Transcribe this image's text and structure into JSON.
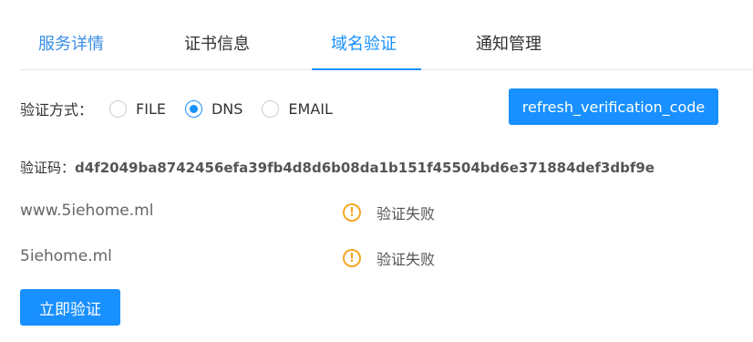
{
  "tabs": [
    {
      "label": "服务详情"
    },
    {
      "label": "证书信息"
    },
    {
      "label": "域名验证"
    },
    {
      "label": "通知管理"
    }
  ],
  "verification": {
    "method_label": "验证方式：",
    "options": [
      "FILE",
      "DNS",
      "EMAIL"
    ],
    "selected": "DNS",
    "refresh_button": "refresh_verification_code",
    "code_label": "验证码：",
    "code_value": "d4f2049ba8742456efa39fb4d8d6b08da1b151f45504bd6e371884def3dbf9e"
  },
  "domains": [
    {
      "name": "www.5iehome.ml",
      "status": "验证失败"
    },
    {
      "name": "5iehome.ml",
      "status": "验证失败"
    }
  ],
  "verify_button": "立即验证",
  "colors": {
    "accent": "#1890ff",
    "warning": "#f5a623"
  }
}
